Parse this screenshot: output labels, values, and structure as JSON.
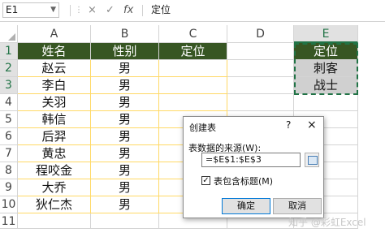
{
  "formula_bar": {
    "name_box": "E1",
    "cancel_icon": "×",
    "enter_icon": "✓",
    "fx_icon": "fx",
    "content": "定位"
  },
  "columns": [
    "A",
    "B",
    "C",
    "D",
    "E"
  ],
  "rows": [
    "1",
    "2",
    "3",
    "4",
    "5",
    "6",
    "7",
    "8",
    "9",
    "10",
    "11"
  ],
  "sheet": {
    "headers": {
      "a": "姓名",
      "b": "性别",
      "c": "定位",
      "e": "定位"
    },
    "names": [
      "赵云",
      "李白",
      "关羽",
      "韩信",
      "后羿",
      "黄忠",
      "程咬金",
      "大乔",
      "狄仁杰"
    ],
    "genders": [
      "男",
      "男",
      "男",
      "男",
      "男",
      "男",
      "男",
      "男",
      "男"
    ],
    "e_values": [
      "刺客",
      "战士"
    ]
  },
  "dialog": {
    "title": "创建表",
    "help": "?",
    "close": "×",
    "range_label": "表数据的来源(W):",
    "range_value": "=$E$1:$E$3",
    "checkbox_mark": "✓",
    "checkbox_label": "表包含标题(M)",
    "ok": "确定",
    "cancel": "取消"
  },
  "watermark": "知乎 @彩虹Excel",
  "colors": {
    "header_fill": "#375623",
    "selection_fill": "#d0d0d0",
    "accent": "#217346",
    "data_border": "#ffd966"
  }
}
